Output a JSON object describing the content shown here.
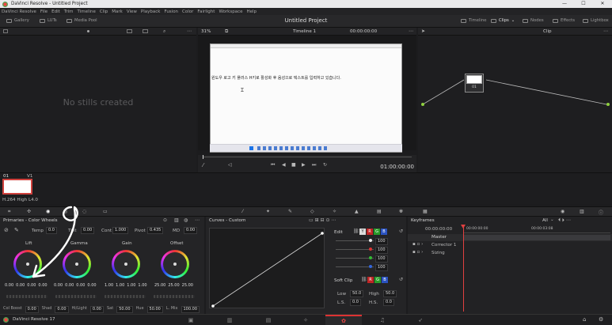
{
  "window": {
    "title": "DaVinci Resolve - Untitled Project",
    "min": "—",
    "max": "☐",
    "close": "✕"
  },
  "menu": [
    "DaVinci Resolve",
    "File",
    "Edit",
    "Trim",
    "Timeline",
    "Clip",
    "Mark",
    "View",
    "Playback",
    "Fusion",
    "Color",
    "Fairlight",
    "Workspace",
    "Help"
  ],
  "header": {
    "project_title": "Untitled Project",
    "gallery": "Gallery",
    "luts": "LUTs",
    "media_pool": "Media Pool",
    "timeline": "Timeline",
    "clips": "Clips",
    "nodes": "Nodes",
    "effects": "Effects",
    "lightbox": "Lightbox"
  },
  "viewer": {
    "zoom": "31%",
    "timeline_name": "Timeline 1",
    "timecode_top": "00:00:00:00",
    "timecode": "01:00:00:00",
    "korean_text": "윈도우 로고 키 플러스 H키로 활성화 후 음성으로 텍스트를 입력하고 있습니다."
  },
  "gallery": {
    "empty_text": "No stills created"
  },
  "nodes": {
    "mode": "Clip",
    "node_label": "01"
  },
  "clips": {
    "index": "01",
    "track": "V1",
    "codec": "H.264 High L4.0"
  },
  "primaries": {
    "title": "Primaries - Color Wheels",
    "temp_label": "Temp",
    "temp": "0.0",
    "tint_label": "Tint",
    "tint": "0.00",
    "cont_label": "Cont",
    "cont": "1.000",
    "pivot_label": "Pivot",
    "pivot": "0.435",
    "md_label": "MD",
    "md": "0.00",
    "wheels": [
      {
        "name": "Lift",
        "values": [
          "0.00",
          "0.00",
          "0.00",
          "0.00"
        ]
      },
      {
        "name": "Gamma",
        "values": [
          "0.00",
          "0.00",
          "0.00",
          "0.00"
        ]
      },
      {
        "name": "Gain",
        "values": [
          "1.00",
          "1.00",
          "1.00",
          "1.00"
        ]
      },
      {
        "name": "Offset",
        "values": [
          "25.00",
          "25.00",
          "25.00"
        ]
      }
    ],
    "bottom": [
      {
        "label": "Col Boost",
        "value": "0.00"
      },
      {
        "label": "Shad",
        "value": "0.00"
      },
      {
        "label": "Hi/Light",
        "value": "0.00"
      },
      {
        "label": "Sat",
        "value": "50.00"
      },
      {
        "label": "Hue",
        "value": "50.00"
      },
      {
        "label": "L. Mix",
        "value": "100.00"
      }
    ]
  },
  "curves": {
    "title": "Curves - Custom",
    "edit": "Edit",
    "values": [
      "100",
      "100",
      "100",
      "100"
    ],
    "soft_clip": "Soft Clip",
    "low_label": "Low",
    "low": "50.0",
    "high_label": "High",
    "high": "50.0",
    "ls_label": "L.S.",
    "ls": "0.0",
    "hs_label": "H.S.",
    "hs": "0.0"
  },
  "keyframes": {
    "title": "Keyframes",
    "filter": "All",
    "timecode": "00:00:00:00",
    "tc2": "00:00:00:00",
    "tc3": "00:00:03:08",
    "rows": [
      "Master",
      "Corrector 1",
      "Sizing"
    ]
  },
  "footer": {
    "app": "DaVinci Resolve 17"
  }
}
